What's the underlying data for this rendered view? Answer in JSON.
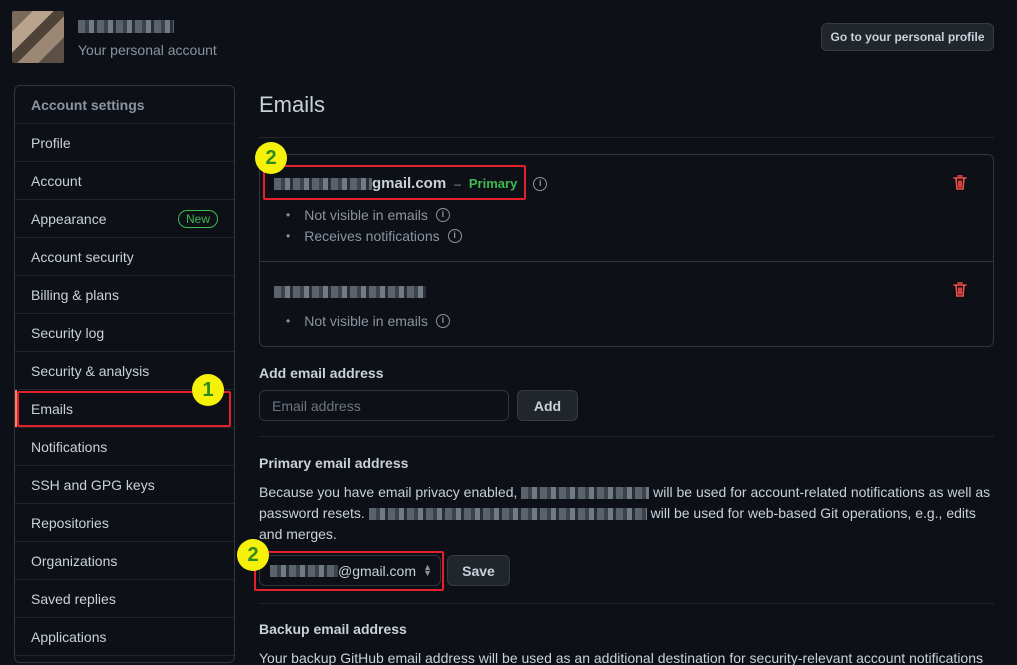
{
  "header": {
    "account_subtitle": "Your personal account",
    "profile_button": "Go to your personal profile"
  },
  "sidebar": {
    "heading": "Account settings",
    "items": [
      {
        "label": "Profile"
      },
      {
        "label": "Account"
      },
      {
        "label": "Appearance",
        "badge": "New"
      },
      {
        "label": "Account security"
      },
      {
        "label": "Billing & plans"
      },
      {
        "label": "Security log"
      },
      {
        "label": "Security & analysis"
      },
      {
        "label": "Emails",
        "active": true
      },
      {
        "label": "Notifications"
      },
      {
        "label": "SSH and GPG keys"
      },
      {
        "label": "Repositories"
      },
      {
        "label": "Organizations"
      },
      {
        "label": "Saved replies"
      },
      {
        "label": "Applications"
      }
    ]
  },
  "main": {
    "title": "Emails",
    "emails": {
      "first": {
        "address": "gmail.com",
        "separator": "–",
        "primary_label": "Primary",
        "notes": [
          "Not visible in emails",
          "Receives notifications"
        ]
      },
      "second": {
        "notes": [
          "Not visible in emails"
        ]
      }
    },
    "add": {
      "label": "Add email address",
      "placeholder": "Email address",
      "button": "Add"
    },
    "primary": {
      "label": "Primary email address",
      "text_1": "Because you have email privacy enabled,",
      "text_2": "will be used for account-related notifications as well as",
      "text_3": "password resets.",
      "text_4": "will be used for web-based Git operations, e.g., edits",
      "text_5": "and merges.",
      "select_value": "@gmail.com",
      "save_button": "Save"
    },
    "backup": {
      "label": "Backup email address",
      "text": "Your backup GitHub email address will be used as an additional destination for security-relevant account notifications"
    }
  },
  "annotations": {
    "step_sidebar": "1",
    "step_email": "2",
    "step_select": "2"
  },
  "colors": {
    "background": "#0d1117",
    "primary_green": "#3fb950",
    "danger_red": "#f85149",
    "annotation_red": "#e5202a",
    "annotation_yellow": "#f5f10a"
  }
}
